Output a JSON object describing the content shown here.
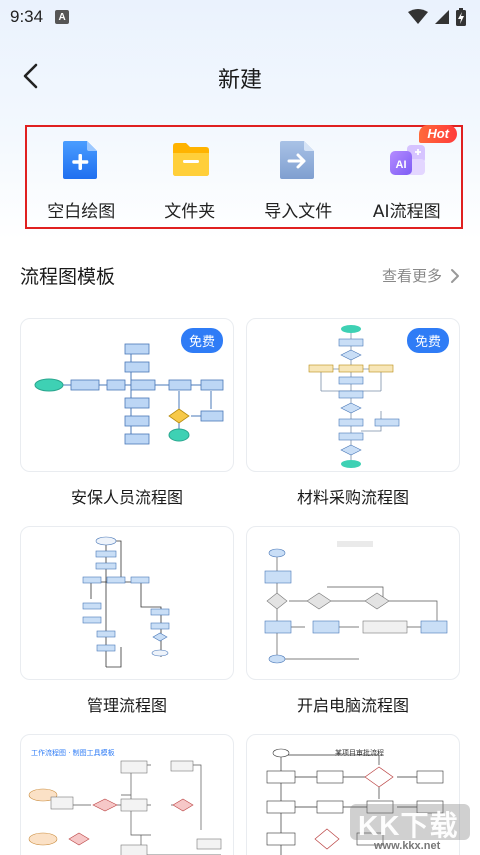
{
  "status_bar": {
    "time": "9:34",
    "notification_icon": "A"
  },
  "header": {
    "title": "新建"
  },
  "actions": [
    {
      "label": "空白绘图",
      "icon": "blank-doc-plus-icon"
    },
    {
      "label": "文件夹",
      "icon": "folder-icon"
    },
    {
      "label": "导入文件",
      "icon": "import-file-icon"
    },
    {
      "label": "AI流程图",
      "icon": "ai-flowchart-icon",
      "badge": "Hot"
    }
  ],
  "templates_section": {
    "title": "流程图模板",
    "view_more": "查看更多"
  },
  "templates": [
    {
      "name": "安保人员流程图",
      "badge": "免费"
    },
    {
      "name": "材料采购流程图",
      "badge": "免费"
    },
    {
      "name": "管理流程图"
    },
    {
      "name": "开启电脑流程图"
    },
    {
      "name": "",
      "thumb_title": "工作流程图 · 制图工具模板"
    },
    {
      "name": "",
      "thumb_title": "某项目审批流程"
    }
  ],
  "watermark": {
    "text": "KK下载",
    "url": "www.kkx.net"
  },
  "colors": {
    "accent": "#2f7cf6",
    "highlight_border": "#e02020",
    "hot_badge": "#ff4a3a"
  }
}
